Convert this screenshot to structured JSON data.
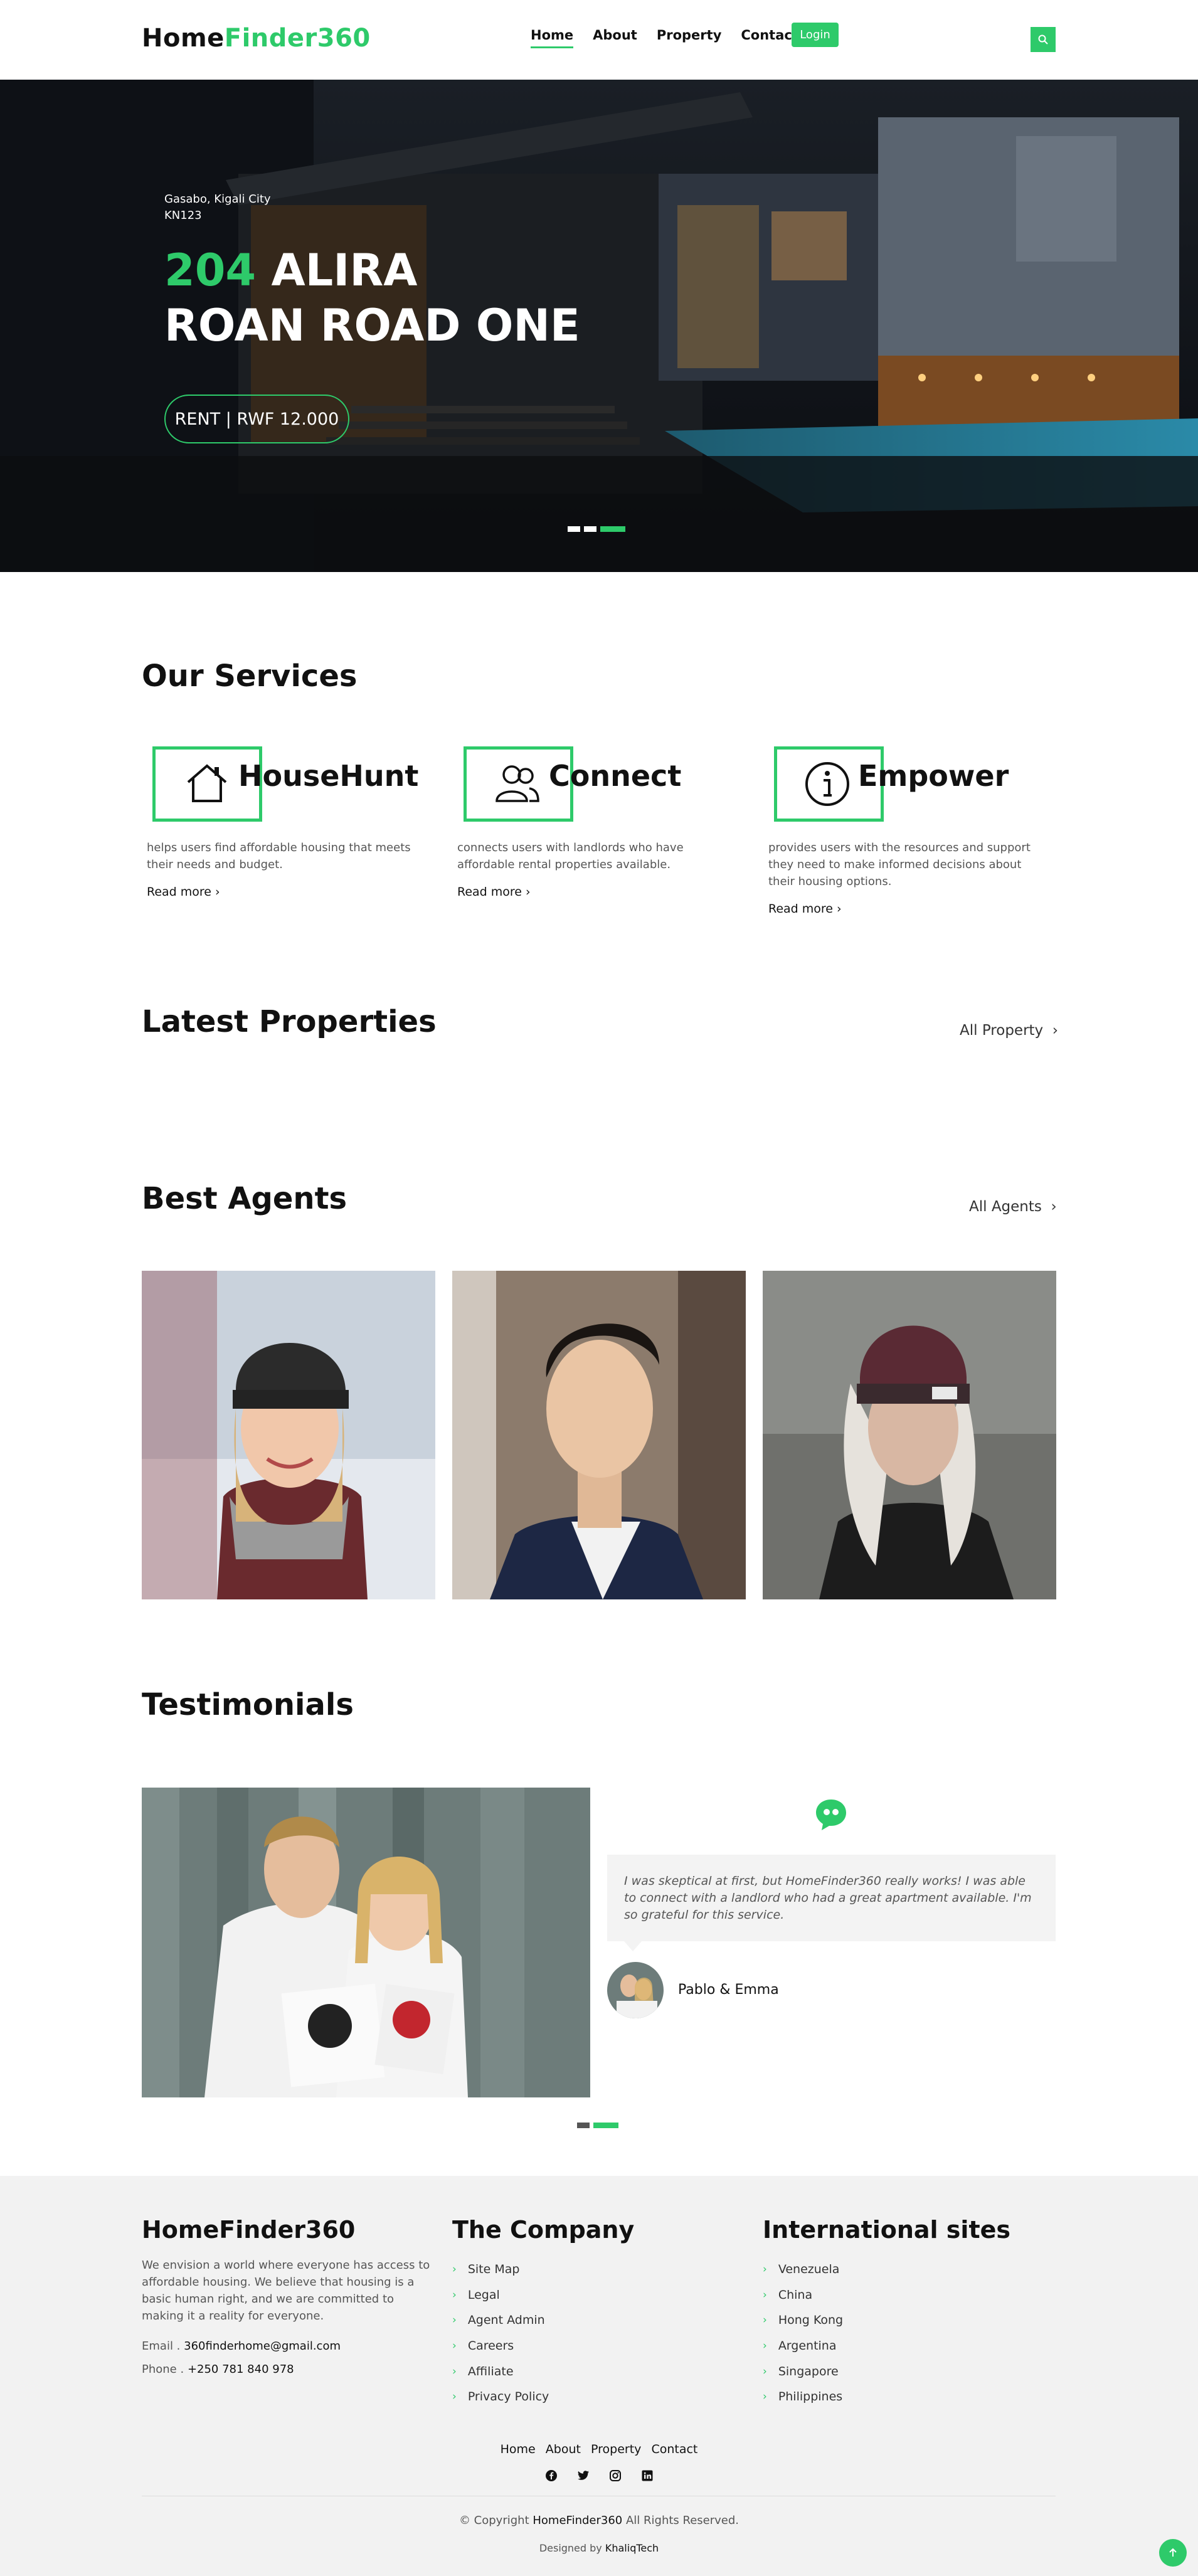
{
  "header": {
    "logo_part1": "Home",
    "logo_part2": "Finder360",
    "nav": [
      "Home",
      "About",
      "Property",
      "Contact"
    ],
    "login_label": "Login"
  },
  "hero": {
    "location_line1": "Gasabo, Kigali City",
    "location_line2": "KN123",
    "title_number": "204",
    "title_line1_rest": " ALIRA",
    "title_line2": "ROAN ROAD ONE",
    "price": "RENT | RWF 12.000"
  },
  "services": {
    "title": "Our Services",
    "items": [
      {
        "title": "HouseHunt",
        "icon": "house-icon",
        "desc": "helps users find affordable housing that meets their needs and budget.",
        "link": "Read more"
      },
      {
        "title": "Connect",
        "icon": "users-icon",
        "desc": "connects users with landlords who have affordable rental properties available.",
        "link": "Read more"
      },
      {
        "title": "Empower",
        "icon": "info-icon",
        "desc": "provides users with the resources and support they need to make informed decisions about their housing options.",
        "link": "Read more"
      }
    ]
  },
  "latest": {
    "title": "Latest Properties",
    "link": "All Property"
  },
  "agents": {
    "title": "Best Agents",
    "link": "All Agents"
  },
  "testimonials": {
    "title": "Testimonials",
    "quote": "I was skeptical at first, but HomeFinder360 really works! I was able to connect with a landlord who had a great apartment available. I'm so grateful for this service.",
    "author": "Pablo & Emma"
  },
  "footer": {
    "brand": "HomeFinder360",
    "about": "We envision a world where everyone has access to affordable housing. We believe that housing is a basic human right, and we are committed to making it a reality for everyone.",
    "email_label": "Email .",
    "email": "360finderhome@gmail.com",
    "phone_label": "Phone .",
    "phone": "+250 781 840 978",
    "company_title": "The Company",
    "company_links": [
      "Site Map",
      "Legal",
      "Agent Admin",
      "Careers",
      "Affiliate",
      "Privacy Policy"
    ],
    "intl_title": "International sites",
    "intl_links": [
      "Venezuela",
      "China",
      "Hong Kong",
      "Argentina",
      "Singapore",
      "Philippines"
    ],
    "bottom_nav": [
      "Home",
      "About",
      "Property",
      "Contact"
    ],
    "copyright_pre": "© Copyright",
    "copyright_brand": "HomeFinder360",
    "copyright_post": "All Rights Reserved.",
    "designed_pre": "Designed by",
    "designed_by": "KhaliqTech"
  },
  "colors": {
    "accent": "#2eca6a",
    "footer_bg": "#f2f2f2"
  }
}
